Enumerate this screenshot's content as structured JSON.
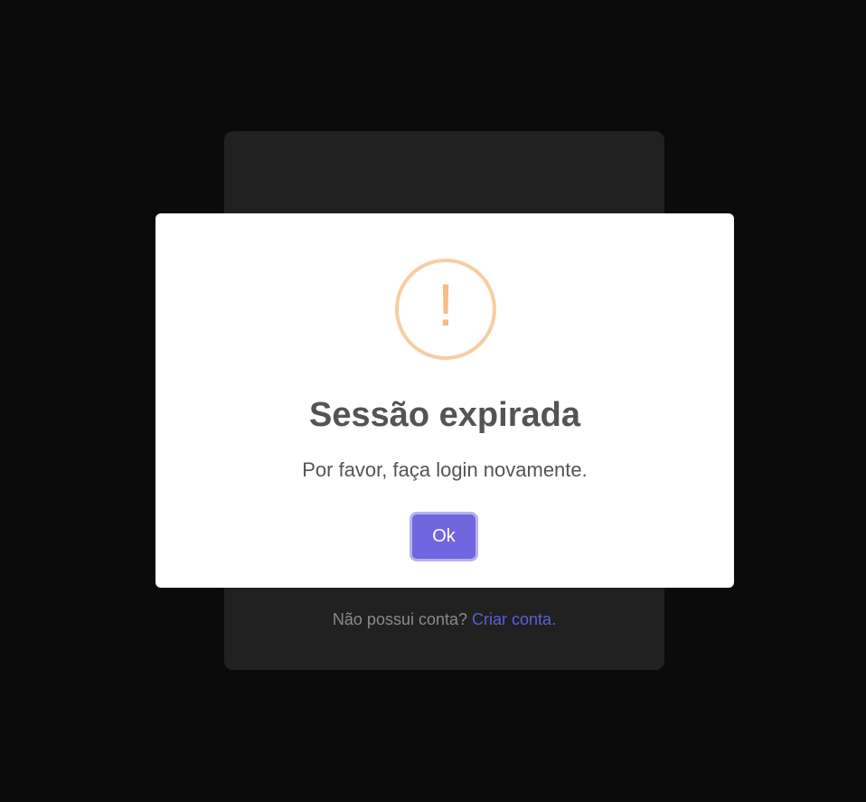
{
  "login_card": {
    "signup_prompt": "Não possui conta?",
    "signup_link": "Criar conta."
  },
  "modal": {
    "icon": "warning-icon",
    "icon_glyph": "!",
    "title": "Sessão expirada",
    "text": "Por favor, faça login novamente.",
    "confirm_label": "Ok"
  },
  "colors": {
    "background": "#0b0b0b",
    "card": "#212121",
    "modal": "#ffffff",
    "warning": "#f8bb86",
    "confirm_button": "#7066e0",
    "link": "#5b5fd6"
  }
}
